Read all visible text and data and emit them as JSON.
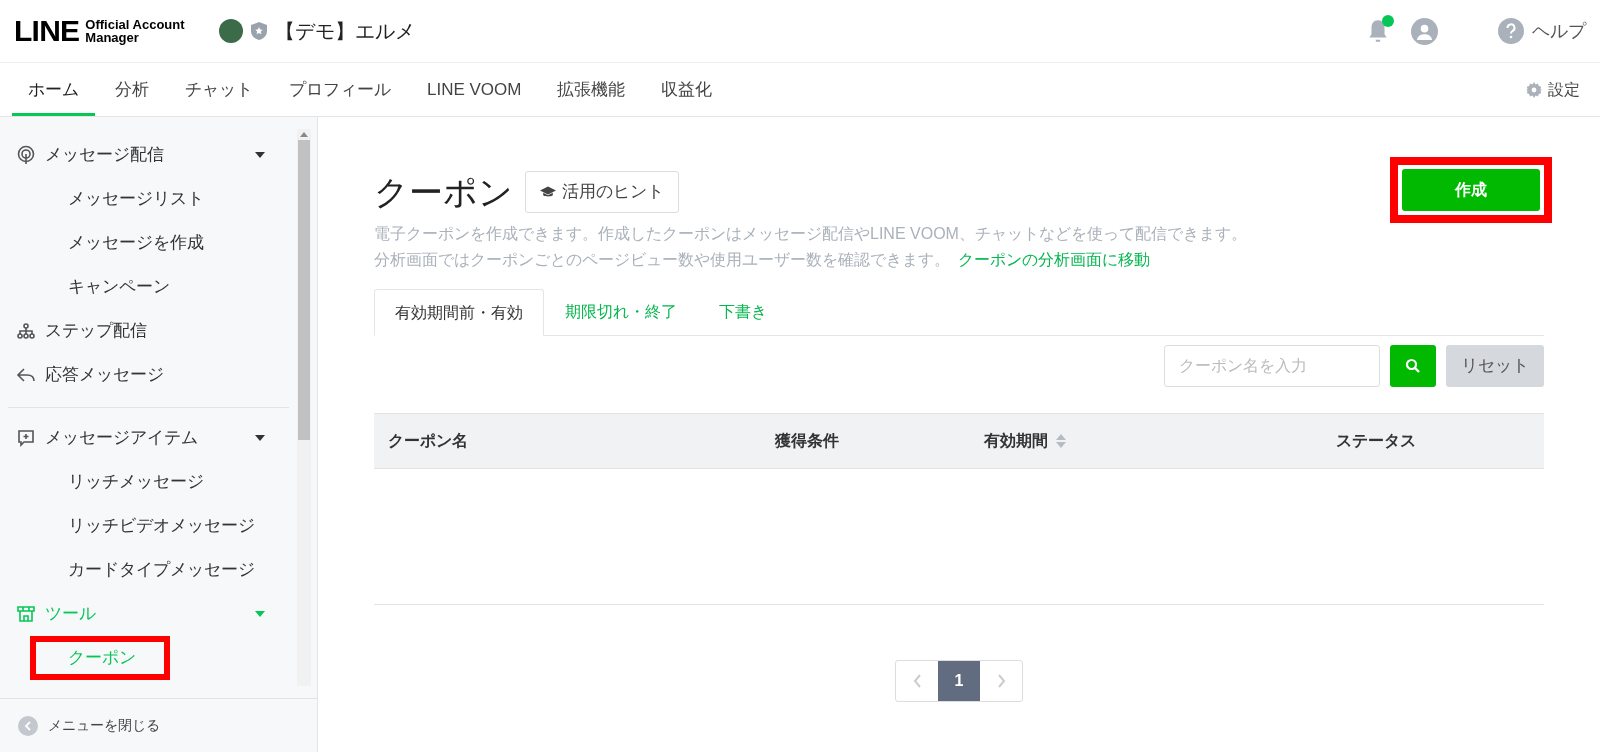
{
  "header": {
    "logo_main": "LINE",
    "logo_sub_1": "Official Account",
    "logo_sub_2": "Manager",
    "account_name": "【デモ】エルメ",
    "notification_unread": true,
    "help": "ヘルプ"
  },
  "nav": {
    "tabs": [
      {
        "label": "ホーム",
        "selected": true
      },
      {
        "label": "分析",
        "selected": false
      },
      {
        "label": "チャット",
        "selected": false
      },
      {
        "label": "プロフィール",
        "selected": false
      },
      {
        "label": "LINE VOOM",
        "selected": false
      },
      {
        "label": "拡張機能",
        "selected": false
      },
      {
        "label": "収益化",
        "selected": false
      }
    ],
    "settings": "設定"
  },
  "sidebar": {
    "sections": [
      {
        "items": [
          {
            "kind": "broadcast",
            "label": "メッセージ配信",
            "expanded": true,
            "selected": false,
            "children": [
              {
                "label": "メッセージリスト",
                "selected": false,
                "highlighted": false
              },
              {
                "label": "メッセージを作成",
                "selected": false,
                "highlighted": false
              },
              {
                "label": "キャンペーン",
                "selected": false,
                "highlighted": false
              }
            ]
          },
          {
            "kind": "step",
            "label": "ステップ配信",
            "selected": false
          },
          {
            "kind": "reply",
            "label": "応答メッセージ",
            "selected": false
          }
        ]
      },
      {
        "items": [
          {
            "kind": "item",
            "label": "メッセージアイテム",
            "expanded": true,
            "selected": false,
            "children": [
              {
                "label": "リッチメッセージ",
                "selected": false,
                "highlighted": false
              },
              {
                "label": "リッチビデオメッセージ",
                "selected": false,
                "highlighted": false
              },
              {
                "label": "カードタイプメッセージ",
                "selected": false,
                "highlighted": false
              }
            ]
          },
          {
            "kind": "tool",
            "label": "ツール",
            "expanded": true,
            "selected": true,
            "children": [
              {
                "label": "クーポン",
                "selected": true,
                "highlighted": true
              }
            ]
          }
        ]
      }
    ],
    "close_menu": "メニューを閉じる"
  },
  "page": {
    "title": "クーポン",
    "hint_button": "活用のヒント",
    "create_button": {
      "label": "作成",
      "highlighted": true
    },
    "description_1": "電子クーポンを作成できます。作成したクーポンはメッセージ配信やLINE VOOM、チャットなどを使って配信できます。",
    "description_2": "分析画面ではクーポンごとのページビュー数や使用ユーザー数を確認できます。",
    "analysis_link": "クーポンの分析画面に移動",
    "tabs": [
      {
        "label": "有効期間前・有効",
        "selected": true
      },
      {
        "label": "期限切れ・終了",
        "selected": false
      },
      {
        "label": "下書き",
        "selected": false
      }
    ],
    "search": {
      "placeholder": "クーポン名を入力"
    },
    "reset_button": "リセット",
    "table": {
      "columns": [
        {
          "label": "クーポン名"
        },
        {
          "label": "獲得条件"
        },
        {
          "label": "有効期間",
          "sortable": true
        },
        {
          "label": "ステータス"
        }
      ]
    },
    "pagination": {
      "pages": [
        {
          "label": "1",
          "selected": true
        }
      ]
    }
  }
}
